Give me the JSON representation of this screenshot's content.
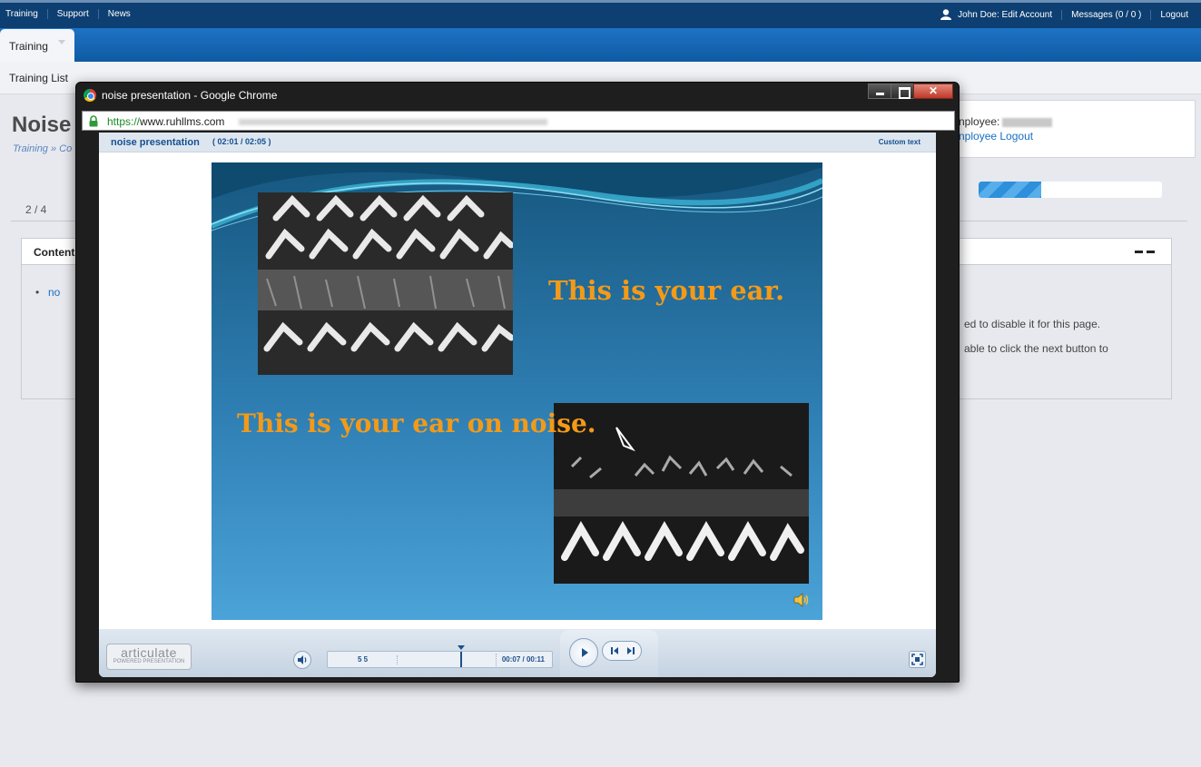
{
  "topbar": {
    "left_links": [
      "Training",
      "Support",
      "News"
    ],
    "user_label": "John Doe: Edit Account",
    "messages_label": "Messages (0 / 0 )",
    "logout_label": "Logout"
  },
  "tabs": {
    "active_label": "Training"
  },
  "subnav": {
    "label": "Training List"
  },
  "page": {
    "title": "Noise",
    "breadcrumb": "Training »  Co",
    "counter": "2 / 4",
    "employee_label": "nployee:",
    "employee_logout": "nployee Logout",
    "progress_fraction": 0.34,
    "content_heading": "Content",
    "content_item": "no",
    "side_text_1": "ed to disable it for this page.",
    "side_text_2": "able to click the next button to"
  },
  "popup": {
    "window_title": "noise presentation - Google Chrome",
    "url_protocol": "https://",
    "url_host": "www.ruhllms.com",
    "player": {
      "title": "noise presentation",
      "time": "( 02:01 / 02:05 )",
      "custom_link": "Custom text",
      "slide_text_1": "This is your ear.",
      "slide_text_2": "This is your ear on noise.",
      "brand_line_1": "articulate",
      "brand_line_2": "POWERED PRESENTATION",
      "track_label": "5 5",
      "track_time": "00:07 / 00:11",
      "playhead_fraction": 0.59
    }
  },
  "colors": {
    "top_bar": "#0d3f72",
    "tab_bar": "#1e73c4",
    "slide_text": "#f39a18",
    "slide_bg": "#2f7fb4"
  },
  "icons": [
    "user-icon",
    "chrome-logo-icon",
    "minimize-icon",
    "maximize-icon",
    "close-icon",
    "lock-icon",
    "speaker-icon",
    "volume-icon",
    "play-icon",
    "prev-icon",
    "next-icon",
    "fullscreen-icon",
    "pointer-icon"
  ]
}
